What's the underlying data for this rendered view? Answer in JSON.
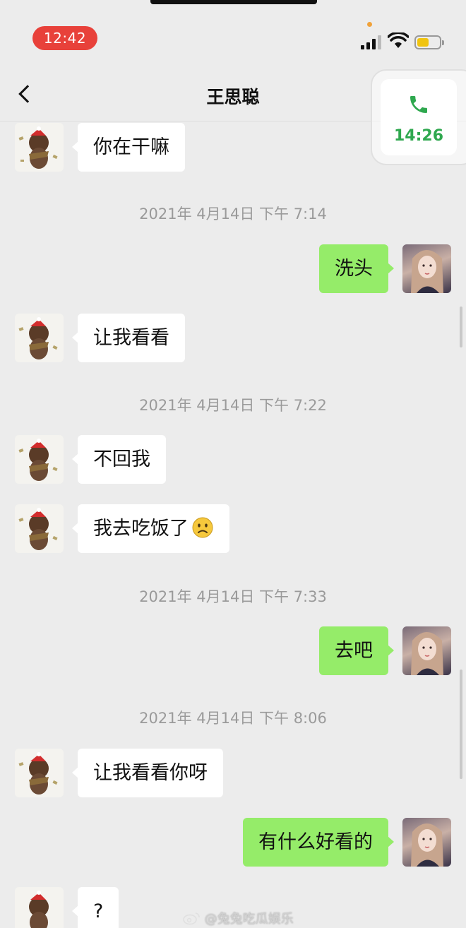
{
  "status_bar": {
    "time": "12:42"
  },
  "header": {
    "title": "王思聪"
  },
  "call_widget": {
    "elapsed": "14:26"
  },
  "messages": [
    {
      "side": "left",
      "text": "你在干嘛"
    },
    {
      "timestamp": "2021年 4月14日 下午 7:14"
    },
    {
      "side": "right",
      "text": "洗头"
    },
    {
      "side": "left",
      "text": "让我看看"
    },
    {
      "timestamp": "2021年 4月14日 下午 7:22"
    },
    {
      "side": "left",
      "text": "不回我"
    },
    {
      "side": "left",
      "text": "我去吃饭了",
      "emoji": "frown-emoji"
    },
    {
      "timestamp": "2021年 4月14日 下午 7:33"
    },
    {
      "side": "right",
      "text": "去吧"
    },
    {
      "timestamp": "2021年 4月14日 下午 8:06"
    },
    {
      "side": "left",
      "text": "让我看看你呀"
    },
    {
      "side": "right",
      "text": "有什么好看的"
    },
    {
      "side": "left",
      "text": "?"
    }
  ],
  "watermark": "@兔兔吃瓜娱乐",
  "colors": {
    "sent_bubble": "#95ec69",
    "received_bubble": "#ffffff",
    "background": "#ececec",
    "call_green": "#2fa84f",
    "time_pill": "#e8413a"
  }
}
